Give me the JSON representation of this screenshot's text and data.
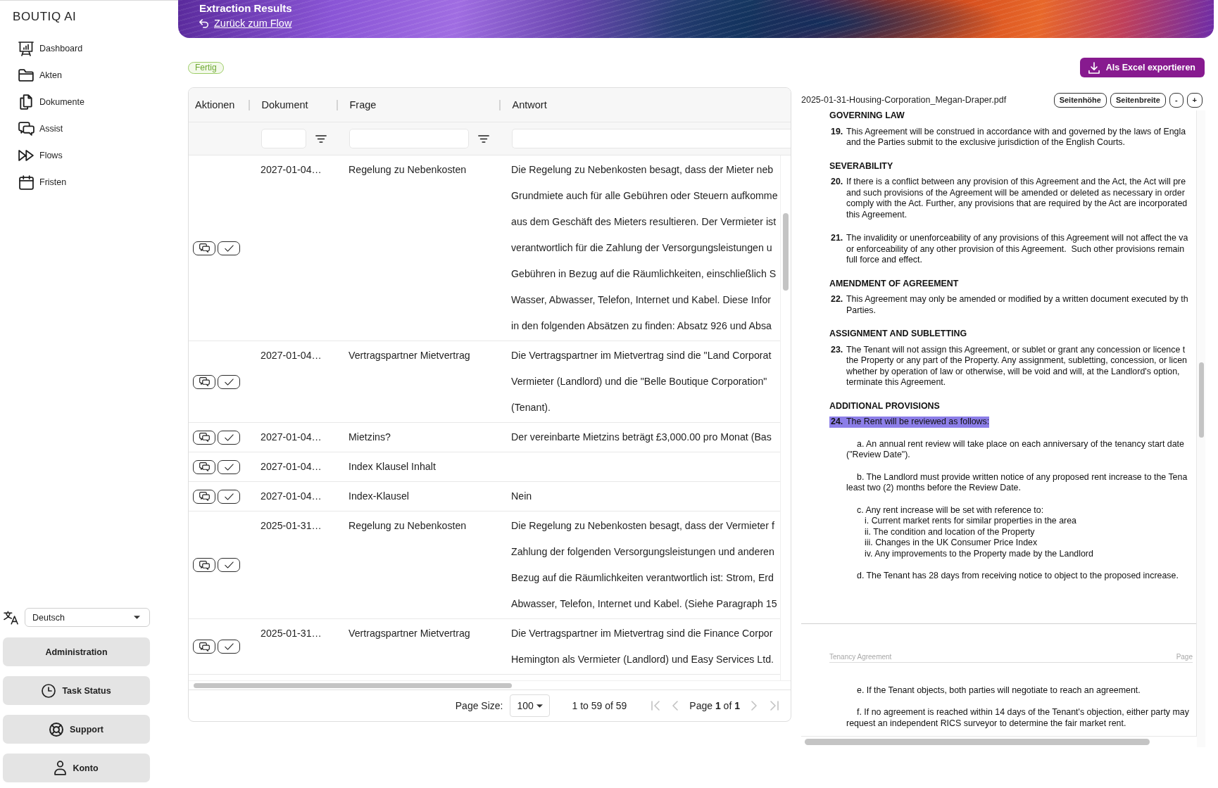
{
  "sidebar": {
    "logo": "BOUTIQ AI",
    "items": [
      {
        "label": "Dashboard"
      },
      {
        "label": "Akten"
      },
      {
        "label": "Dokumente"
      },
      {
        "label": "Assist"
      },
      {
        "label": "Flows"
      },
      {
        "label": "Fristen"
      }
    ],
    "language": {
      "value": "Deutsch"
    },
    "buttons": [
      {
        "label": "Administration"
      },
      {
        "label": "Task Status"
      },
      {
        "label": "Support"
      },
      {
        "label": "Konto"
      }
    ]
  },
  "header": {
    "title": "Extraction Results",
    "back_link": "Zurück zum Flow"
  },
  "status_badge": {
    "label": "Fertig"
  },
  "export_button": {
    "label": "Als Excel exportieren"
  },
  "table": {
    "columns": [
      {
        "label": "Aktionen",
        "filter_field": false,
        "filter_icon": false
      },
      {
        "label": "Dokument",
        "filter_field": true,
        "filter_icon": true
      },
      {
        "label": "Frage",
        "filter_field": true,
        "filter_icon": true
      },
      {
        "label": "Antwort",
        "filter_field": true,
        "filter_icon": false
      }
    ],
    "rows": [
      {
        "document": "2027-01-04…",
        "question": "Regelung zu Nebenkosten",
        "answer": "Die Regelung zu Nebenkosten besagt, dass der Mieter neb\nGrundmiete auch für alle Gebühren oder Steuern aufkomme\naus dem Geschäft des Mieters resultieren. Der Vermieter ist\nverantwortlich für die Zahlung der Versorgungsleistungen u\nGebühren in Bezug auf die Räumlichkeiten, einschließlich S\nWasser, Abwasser, Telefon, Internet und Kabel. Diese Infor\nin den folgenden Absätzen zu finden: Absatz 926 und Absa"
      },
      {
        "document": "2027-01-04…",
        "question": "Vertragspartner Mietvertrag",
        "answer": "Die Vertragspartner im Mietvertrag sind die \"Land Corporat\nVermieter (Landlord) und die \"Belle Boutique Corporation\"\n(Tenant)."
      },
      {
        "document": "2027-01-04…",
        "question": "Mietzins?",
        "answer": "Der vereinbarte Mietzins beträgt £3,000.00 pro Monat (Bas"
      },
      {
        "document": "2027-01-04…",
        "question": "Index Klausel Inhalt"
      },
      {
        "document": "2027-01-04…",
        "question": "Index-Klausel",
        "answer": "Nein"
      },
      {
        "document": "2025-01-31…",
        "question": "Regelung zu Nebenkosten",
        "answer": "Die Regelung zu Nebenkosten besagt, dass der Vermieter f\nZahlung der folgenden Versorgungsleistungen und anderen\nBezug auf die Räumlichkeiten verantwortlich ist: Strom, Erd\nAbwasser, Telefon, Internet und Kabel. (Siehe Paragraph 15"
      },
      {
        "document": "2025-01-31…",
        "question": "Vertragspartner Mietvertrag",
        "answer": "Die Vertragspartner im Mietvertrag sind die Finance Corpor\nHemington als Vermieter (Landlord) und Easy Services Ltd."
      }
    ],
    "pagination": {
      "page_size_label": "Page Size:",
      "page_size": "100",
      "summary": "1 to 59 of 59",
      "page": "Page **1** of **1**",
      "nav": [
        {
          "kind": "first",
          "disabled": true
        },
        {
          "kind": "previous",
          "disabled": true
        },
        {
          "kind": "next",
          "disabled": true
        },
        {
          "kind": "last",
          "disabled": true
        }
      ]
    }
  },
  "pdf_viewer": {
    "filename": "2025-01-31-Housing-Corporation_Megan-Draper.pdf",
    "controls": [
      "Seitenhöhe",
      "Seitenbreite",
      "-",
      "+"
    ],
    "pages": [
      {
        "blocks": [
          {
            "kind": "heading",
            "text": "GOVERNING LAW"
          },
          {
            "kind": "clause",
            "number": "19.",
            "text": "This Agreement will be construed in accordance with and governed by the laws of Engla\nand the Parties submit to the exclusive jurisdiction of the English Courts.",
            "highlighted": false
          },
          {
            "kind": "heading",
            "text": "SEVERABILITY"
          },
          {
            "kind": "clause",
            "number": "20.",
            "text": "If there is a conflict between any provision of this Agreement and the Act, the Act will pre\nand such provisions of the Agreement will be amended or deleted as necessary in order\ncomply with the Act. Further, any provisions that are required by the Act are incorporated\nthis Agreement.",
            "highlighted": false
          },
          {
            "kind": "clause",
            "number": "21.",
            "text": "The invalidity or unenforceability of any provisions of this Agreement will not affect the va\nor enforceability of any other provision of this Agreement.  Such other provisions remain\nfull force and effect.",
            "highlighted": false
          },
          {
            "kind": "heading",
            "text": "AMENDMENT OF AGREEMENT"
          },
          {
            "kind": "clause",
            "number": "22.",
            "text": "This Agreement may only be amended or modified by a written document executed by th\nParties.",
            "highlighted": false
          },
          {
            "kind": "heading",
            "text": "ASSIGNMENT AND SUBLETTING"
          },
          {
            "kind": "clause",
            "number": "23.",
            "text": "The Tenant will not assign this Agreement, or sublet or grant any concession or licence t\nthe Property or any part of the Property. Any assignment, subletting, concession, or licen\nwhether by operation of law or otherwise, will be void and will, at the Landlord's option,\nterminate this Agreement.",
            "highlighted": false
          },
          {
            "kind": "heading",
            "text": "ADDITIONAL PROVISIONS"
          },
          {
            "kind": "clause",
            "number": "24.",
            "text": "The Rent will be reviewed as follows:",
            "highlighted": true
          },
          {
            "kind": "subclause",
            "text": "a. An annual rent review will take place on each anniversary of the tenancy start date\n(\"Review Date\")."
          },
          {
            "kind": "subclause",
            "text": "b. The Landlord must provide written notice of any proposed rent increase to the Tena\nleast two (2) months before the Review Date."
          },
          {
            "kind": "subclause",
            "text": "c. Any rent increase will be set with reference to:"
          },
          {
            "kind": "list_item",
            "text": "i. Current market rents for similar properties in the area"
          },
          {
            "kind": "list_item",
            "text": "ii. The condition and location of the Property"
          },
          {
            "kind": "list_item",
            "text": "iii. Changes in the UK Consumer Price Index"
          },
          {
            "kind": "list_item",
            "text": "iv. Any improvements to the Property made by the Landlord"
          },
          {
            "kind": "subclause",
            "text": "d. The Tenant has 28 days from receiving notice to object to the proposed increase."
          }
        ]
      },
      {
        "header": {
          "left": "Tenancy Agreement",
          "right": "Page"
        },
        "blocks": [
          {
            "kind": "subclause",
            "text": "e. If the Tenant objects, both parties will negotiate to reach an agreement."
          },
          {
            "kind": "subclause",
            "text": "f. If no agreement is reached within 14 days of the Tenant's objection, either party may\nrequest an independent RICS surveyor to determine the fair market rent."
          }
        ]
      }
    ]
  }
}
